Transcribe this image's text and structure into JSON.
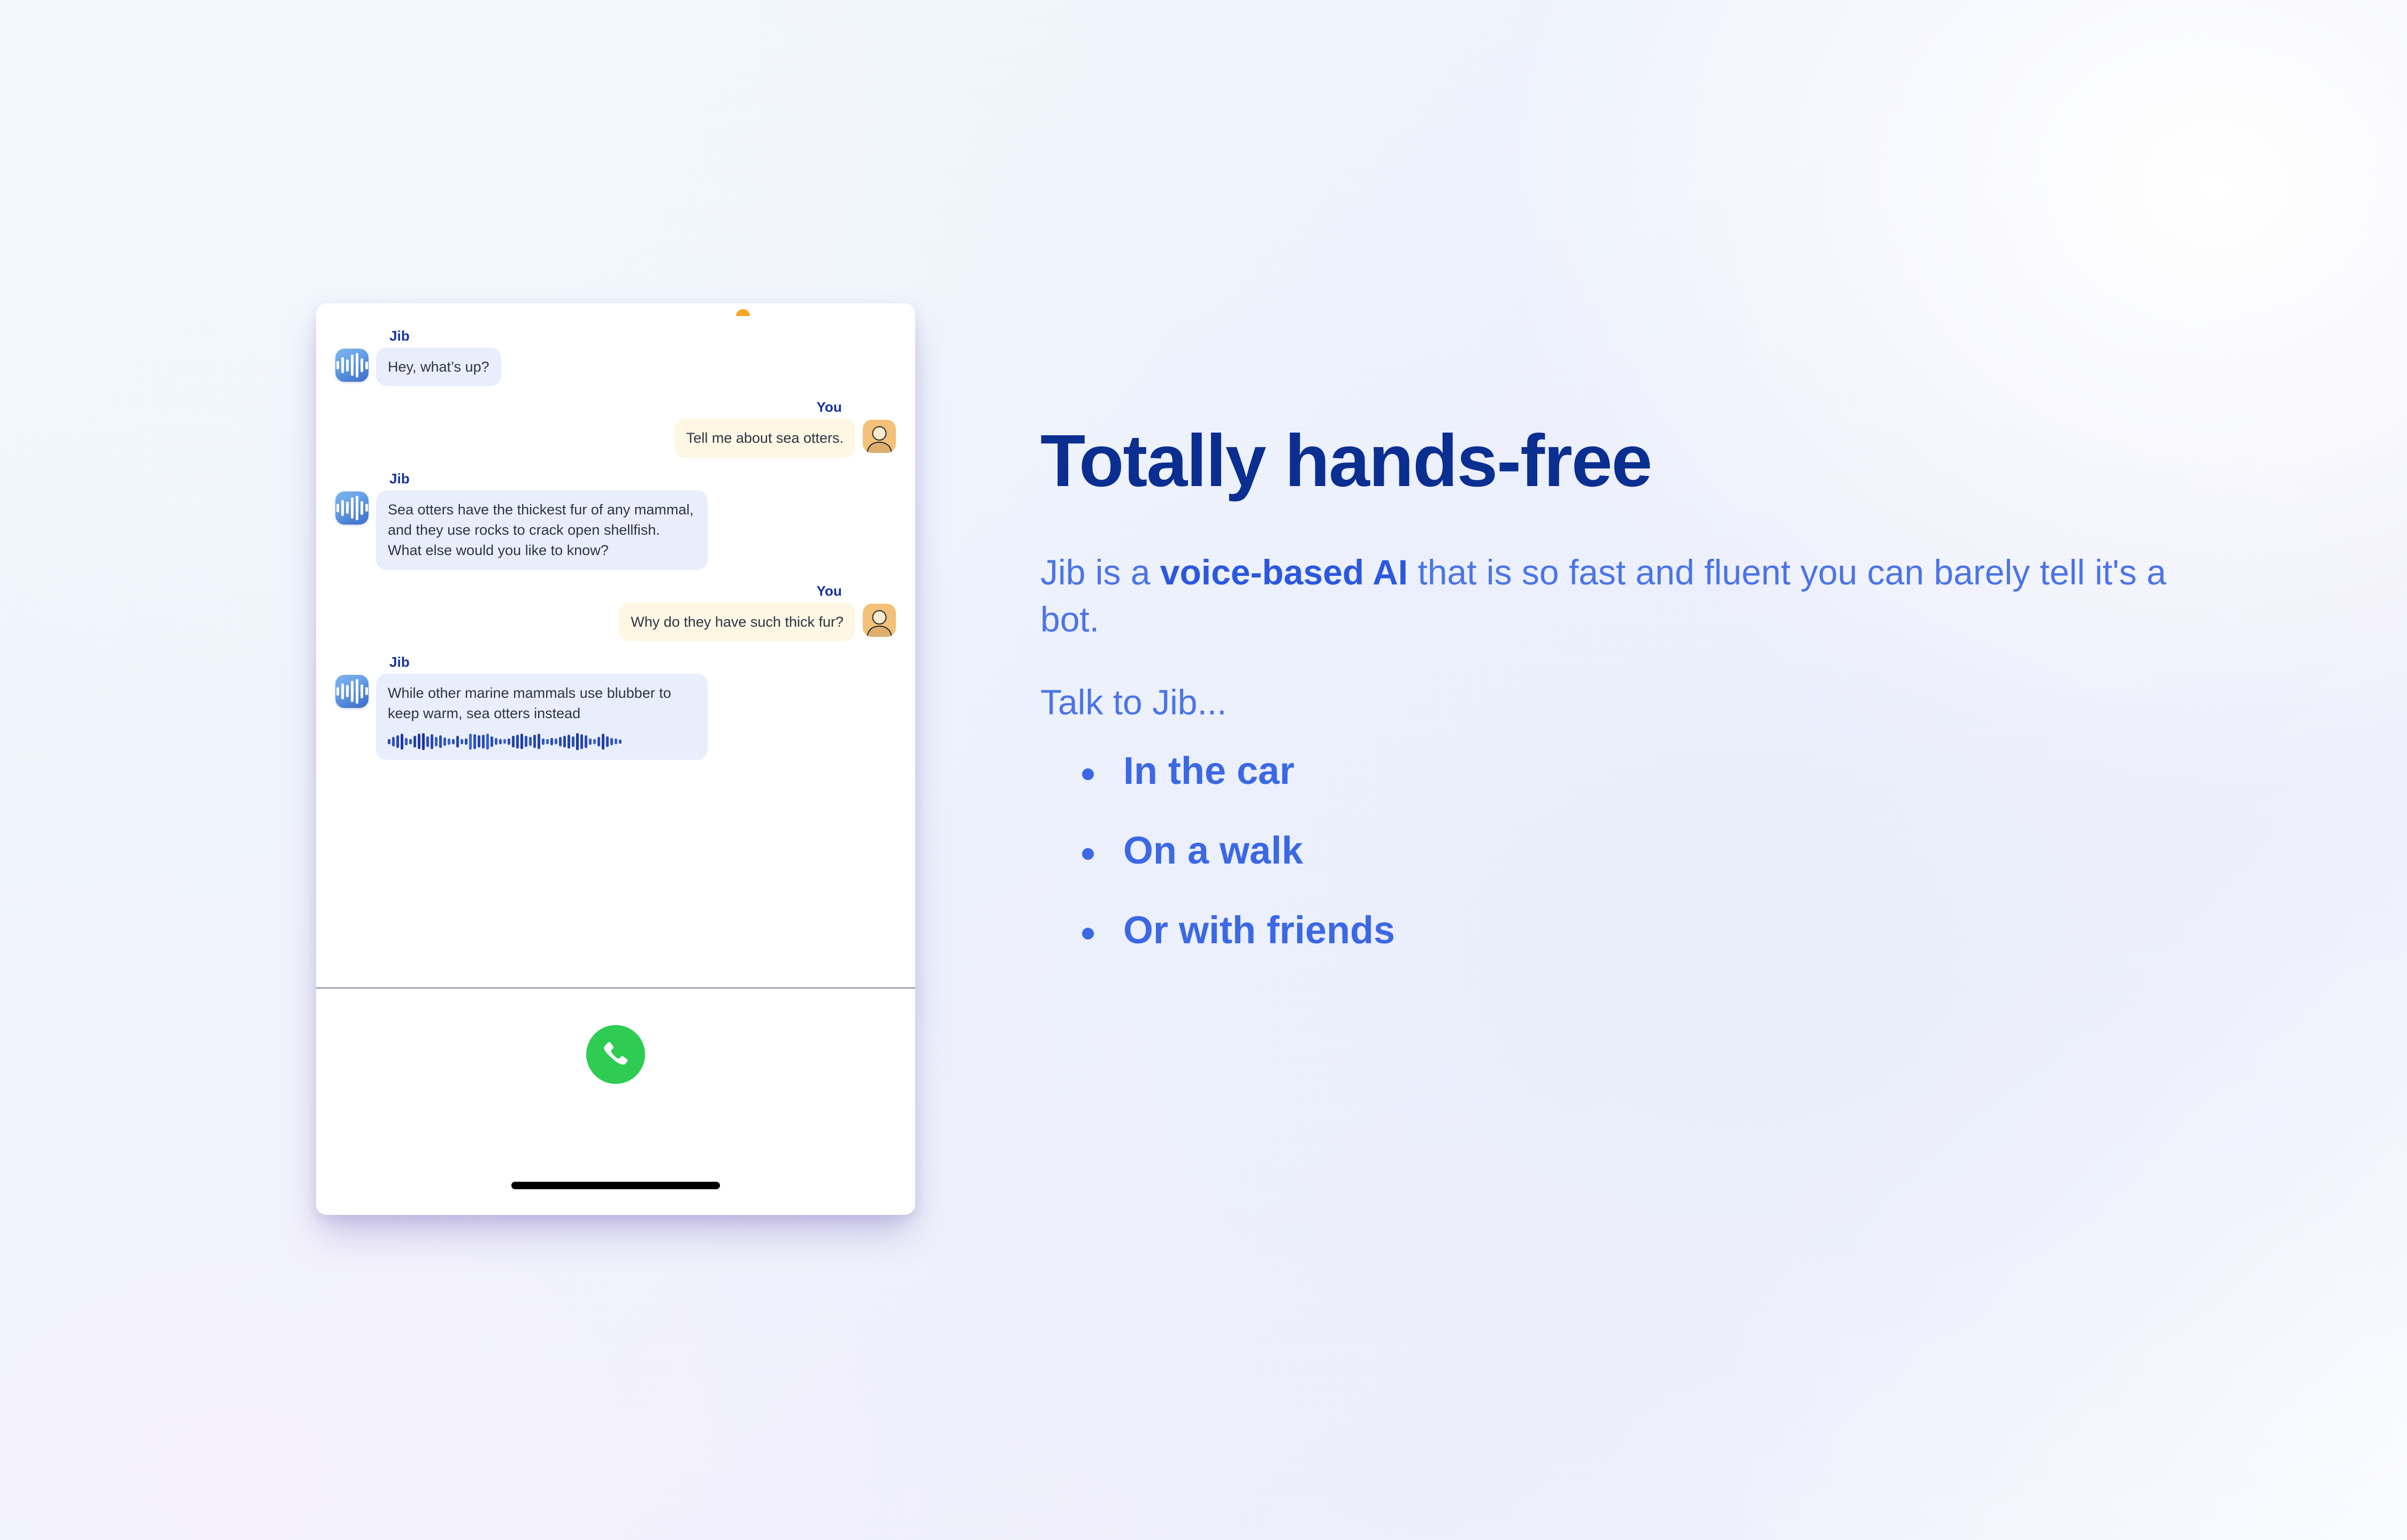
{
  "phone": {
    "notch_indicator": "orange-status-dot",
    "messages": [
      {
        "speaker": "Jib",
        "side": "jib",
        "text": "Hey, what’s up?",
        "has_waveform": false
      },
      {
        "speaker": "You",
        "side": "user",
        "text": "Tell me about sea otters.",
        "has_waveform": false
      },
      {
        "speaker": "Jib",
        "side": "jib",
        "text": "Sea otters have the thickest fur of any mammal, and they use rocks to crack open shellfish. What else would you like to know?",
        "has_waveform": false
      },
      {
        "speaker": "You",
        "side": "user",
        "text": "Why do they have such thick fur?",
        "has_waveform": false
      },
      {
        "speaker": "Jib",
        "side": "jib",
        "text": "While other marine mammals use blubber to keep warm, sea otters instead",
        "has_waveform": true
      }
    ],
    "call_button_label": "Call",
    "bubble_colors": {
      "jib": "#e9eefc",
      "user": "#fdf7e4",
      "speaker_label": "#16339c",
      "call_green": "#2ecc52"
    },
    "waveform_bars": [
      {
        "h": 10,
        "c": "#2a49b8"
      },
      {
        "h": 18,
        "c": "#2f52c4"
      },
      {
        "h": 24,
        "c": "#2a47b4"
      },
      {
        "h": 30,
        "c": "#1f3aa6"
      },
      {
        "h": 14,
        "c": "#3358cc"
      },
      {
        "h": 10,
        "c": "#2e4fc0"
      },
      {
        "h": 22,
        "c": "#27429e"
      },
      {
        "h": 29,
        "c": "#1e3ba8"
      },
      {
        "h": 32,
        "c": "#1b3697"
      },
      {
        "h": 20,
        "c": "#2d4eba"
      },
      {
        "h": 28,
        "c": "#2848b2"
      },
      {
        "h": 18,
        "c": "#3a5fd0"
      },
      {
        "h": 24,
        "c": "#2c4cbb"
      },
      {
        "h": 16,
        "c": "#3257c6"
      },
      {
        "h": 12,
        "c": "#3a61d4"
      },
      {
        "h": 10,
        "c": "#2d4cb6"
      },
      {
        "h": 22,
        "c": "#2545ae"
      },
      {
        "h": 10,
        "c": "#3358c8"
      },
      {
        "h": 12,
        "c": "#2c4cbb"
      },
      {
        "h": 30,
        "c": "#3a66dd"
      },
      {
        "h": 28,
        "c": "#2b4ec2"
      },
      {
        "h": 23,
        "c": "#2446ae"
      },
      {
        "h": 26,
        "c": "#2a4cba"
      },
      {
        "h": 30,
        "c": "#3260d6"
      },
      {
        "h": 20,
        "c": "#2a4ab4"
      },
      {
        "h": 13,
        "c": "#3459c9"
      },
      {
        "h": 10,
        "c": "#2e4fbe"
      },
      {
        "h": 9,
        "c": "#3a62d2"
      },
      {
        "h": 12,
        "c": "#2b4bb6"
      },
      {
        "h": 22,
        "c": "#2646ac"
      },
      {
        "h": 26,
        "c": "#2347ae"
      },
      {
        "h": 29,
        "c": "#1f3ea3"
      },
      {
        "h": 21,
        "c": "#2c4eba"
      },
      {
        "h": 17,
        "c": "#3157c6"
      },
      {
        "h": 25,
        "c": "#2a4ab2"
      },
      {
        "h": 29,
        "c": "#24429f"
      },
      {
        "h": 12,
        "c": "#3156c4"
      },
      {
        "h": 10,
        "c": "#3a61d0"
      },
      {
        "h": 14,
        "c": "#2d4db9"
      },
      {
        "h": 11,
        "c": "#3358c9"
      },
      {
        "h": 18,
        "c": "#2b4ab4"
      },
      {
        "h": 22,
        "c": "#2746ab"
      },
      {
        "h": 26,
        "c": "#2244a6"
      },
      {
        "h": 20,
        "c": "#2c4eb8"
      },
      {
        "h": 32,
        "c": "#1d3a9c"
      },
      {
        "h": 28,
        "c": "#2646ad"
      },
      {
        "h": 24,
        "c": "#2a4ab4"
      },
      {
        "h": 12,
        "c": "#3459c8"
      },
      {
        "h": 10,
        "c": "#3a62d2"
      },
      {
        "h": 18,
        "c": "#2c4cbb"
      },
      {
        "h": 30,
        "c": "#22409f"
      },
      {
        "h": 20,
        "c": "#2948b0"
      },
      {
        "h": 14,
        "c": "#3055c2"
      },
      {
        "h": 11,
        "c": "#3a61d0"
      },
      {
        "h": 8,
        "c": "#2d4db9"
      }
    ]
  },
  "copy": {
    "headline": "Totally hands-free",
    "lead_before": "Jib is a ",
    "lead_bold": "voice-based AI",
    "lead_after": " that is so fast and fluent you can barely tell it's a bot.",
    "talk_label": "Talk to Jib...",
    "use_cases": [
      "In the car",
      "On a walk",
      "Or with friends"
    ]
  },
  "theme": {
    "headline_color": "#0b2e91",
    "body_blue": "#4c74e8",
    "bullet_blue": "#3b68e4"
  }
}
